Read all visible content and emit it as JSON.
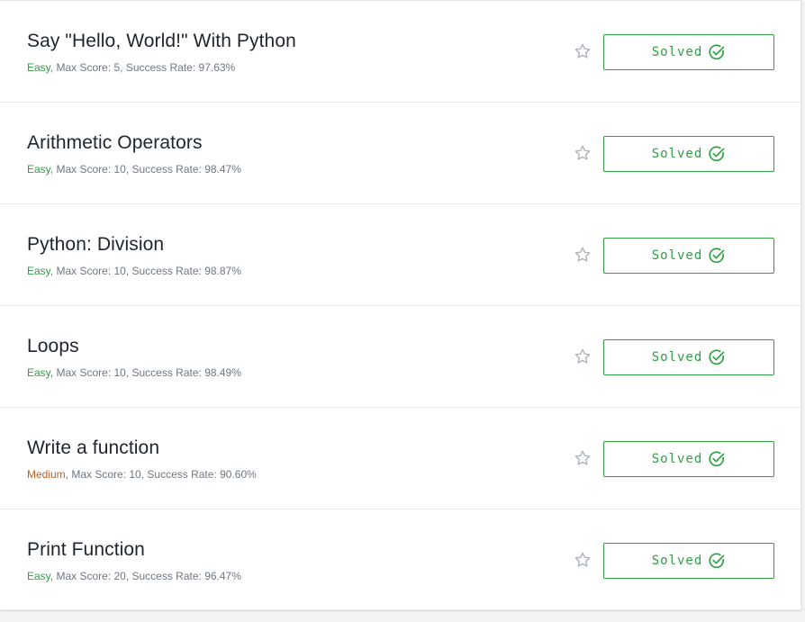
{
  "challenges": [
    {
      "title": "Say \"Hello, World!\" With Python",
      "difficulty": "Easy",
      "rest": ", Max Score: 5, Success Rate: 97.63%",
      "status": "Solved"
    },
    {
      "title": "Arithmetic Operators",
      "difficulty": "Easy",
      "rest": ", Max Score: 10, Success Rate: 98.47%",
      "status": "Solved"
    },
    {
      "title": "Python: Division",
      "difficulty": "Easy",
      "rest": ", Max Score: 10, Success Rate: 98.87%",
      "status": "Solved"
    },
    {
      "title": "Loops",
      "difficulty": "Easy",
      "rest": ", Max Score: 10, Success Rate: 98.49%",
      "status": "Solved"
    },
    {
      "title": "Write a function",
      "difficulty": "Medium",
      "rest": ", Max Score: 10, Success Rate: 90.60%",
      "status": "Solved"
    },
    {
      "title": "Print Function",
      "difficulty": "Easy",
      "rest": ", Max Score: 20, Success Rate: 96.47%",
      "status": "Solved"
    }
  ],
  "icons": {
    "bookmark": "star-icon",
    "solved": "check-circle-icon"
  },
  "colors": {
    "accent_green": "#2ea043",
    "medium_orange": "#c45d1b",
    "meta_gray": "#6f7782",
    "star_gray": "#a9b0b8"
  }
}
